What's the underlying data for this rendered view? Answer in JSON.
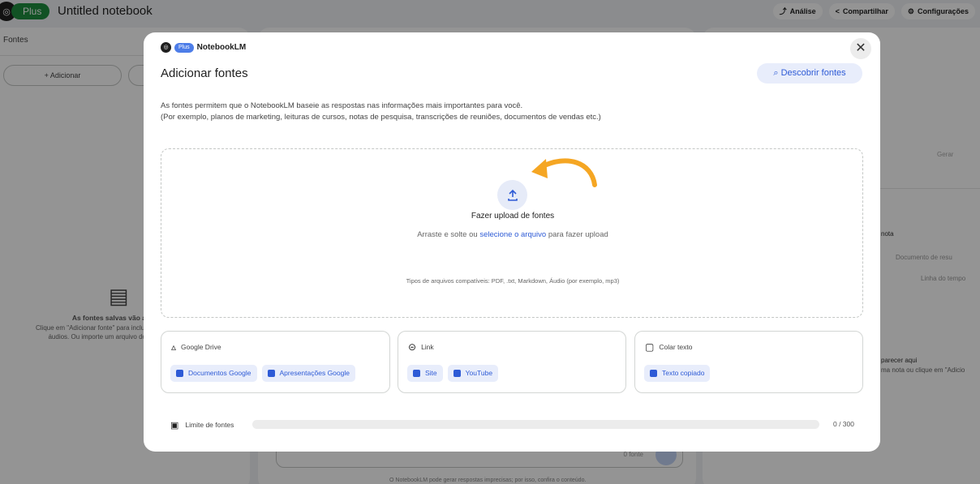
{
  "app": {
    "plan_badge": "Plus",
    "notebook_title": "Untitled notebook",
    "top_actions": [
      {
        "label": "Análise",
        "icon": "trend-icon"
      },
      {
        "label": "Compartilhar",
        "icon": "share-icon"
      },
      {
        "label": "Configurações",
        "icon": "gear-icon"
      }
    ],
    "sources_panel": {
      "title": "Fontes",
      "add_label": "+ Adicionar",
      "empty_title": "As fontes salvas vão a",
      "empty_desc_1": "Clique em \"Adicionar fonte\" para inclui",
      "empty_desc_2": "áudios. Ou importe um arquivo do"
    },
    "right_panel": {
      "generate": "Gerar",
      "note_label": "nota",
      "doc_summary": "Documento de resu",
      "timeline": "Linha do tempo",
      "empty_1": "parecer aqui",
      "empty_2": "ma nota ou clique em \"Adicio"
    },
    "chat": {
      "placeholder": "0 fonte",
      "footer": "O NotebookLM pode gerar respostas imprecisas; por isso, confira o conteúdo."
    }
  },
  "modal": {
    "brand_plus": "Plus",
    "brand_name": "NotebookLM",
    "title": "Adicionar fontes",
    "discover_label": "Descobrir fontes",
    "description_1": "As fontes permitem que o NotebookLM baseie as respostas nas informações mais importantes para você.",
    "description_2": "(Por exemplo, planos de marketing, leituras de cursos, notas de pesquisa, transcrições de reuniões, documentos de vendas etc.)",
    "upload": {
      "title": "Fazer upload de fontes",
      "sub_before": "Arraste e solte ou ",
      "sub_link": "selecione o arquivo",
      "sub_after": " para fazer upload",
      "types": "Tipos de arquivos compatíveis: PDF, .txt, Markdown, Áudio (por exemplo, mp3)"
    },
    "cards": {
      "google_drive": {
        "title": "Google Drive",
        "chips": [
          "Documentos Google",
          "Apresentações Google"
        ]
      },
      "link": {
        "title": "Link",
        "chips": [
          "Site",
          "YouTube"
        ]
      },
      "paste": {
        "title": "Colar texto",
        "chips": [
          "Texto copiado"
        ]
      }
    },
    "limit": {
      "label": "Limite de fontes",
      "count": "0 / 300",
      "used": 0,
      "max": 300
    },
    "accent_color": "#2e5bd6",
    "annotation_arrow_color": "#f5a623"
  }
}
